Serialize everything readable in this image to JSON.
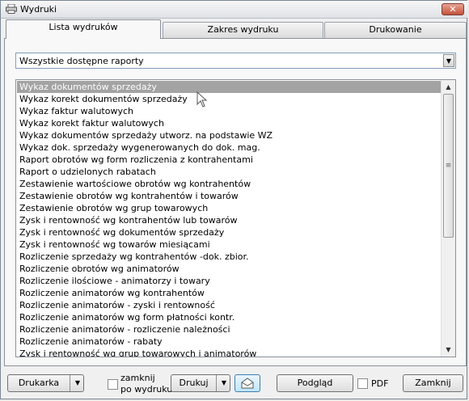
{
  "window": {
    "title": "Wydruki"
  },
  "tabs": [
    {
      "label": "Lista wydruków",
      "active": true
    },
    {
      "label": "Zakres wydruku",
      "active": false
    },
    {
      "label": "Drukowanie",
      "active": false
    }
  ],
  "filter": {
    "selected": "Wszystkie dostępne raporty"
  },
  "reports": [
    "Wykaz dokumentów sprzedaży",
    "Wykaz korekt dokumentów sprzedaży",
    "Wykaz faktur walutowych",
    "Wykaz korekt faktur walutowych",
    "Wykaz dokumentów sprzedaży utworz. na podstawie WZ",
    "Wykaz dok. sprzedaży wygenerowanych do dok. mag.",
    "Raport obrotów wg form rozliczenia z kontrahentami",
    "Raport o udzielonych rabatach",
    "Zestawienie wartościowe obrotów wg kontrahentów",
    "Zestawienie obrotów wg kontrahentów i towarów",
    "Zestawienie obrotów wg grup towarowych",
    "Zysk i rentowność wg kontrahentów lub towarów",
    "Zysk i rentowność wg dokumentów sprzedaży",
    "Zysk i rentowność wg towarów miesiącami",
    "Rozliczenie sprzedaży wg kontrahentów -dok. zbior.",
    "Rozliczenie obrotów wg animatorów",
    "Rozliczenie ilościowe - animatorzy i towary",
    "Rozliczenie animatorów wg kontrahentów",
    "Rozliczenie animatorów - zyski i rentowność",
    "Rozliczenie animatorów wg form płatności kontr.",
    "Rozliczenie animatorów - rozliczenie należności",
    "Rozliczenie animatorów - rabaty",
    "Zysk i rentowność wg grup towarowych i animatorów"
  ],
  "selected_index": 0,
  "bottom": {
    "printer_label": "Drukarka",
    "close_after_label_1": "zamknij",
    "close_after_label_2": "po wydruku",
    "print_label": "Drukuj",
    "preview_label": "Podgląd",
    "pdf_label": "PDF",
    "close_label": "Zamknij"
  },
  "icons": {
    "title": "printer-icon",
    "close": "close-icon",
    "email": "envelope-icon",
    "combo": "chevron-down-icon",
    "scroll_up": "scroll-up-icon",
    "scroll_down": "scroll-down-icon",
    "cursor": "mouse-pointer-icon"
  }
}
